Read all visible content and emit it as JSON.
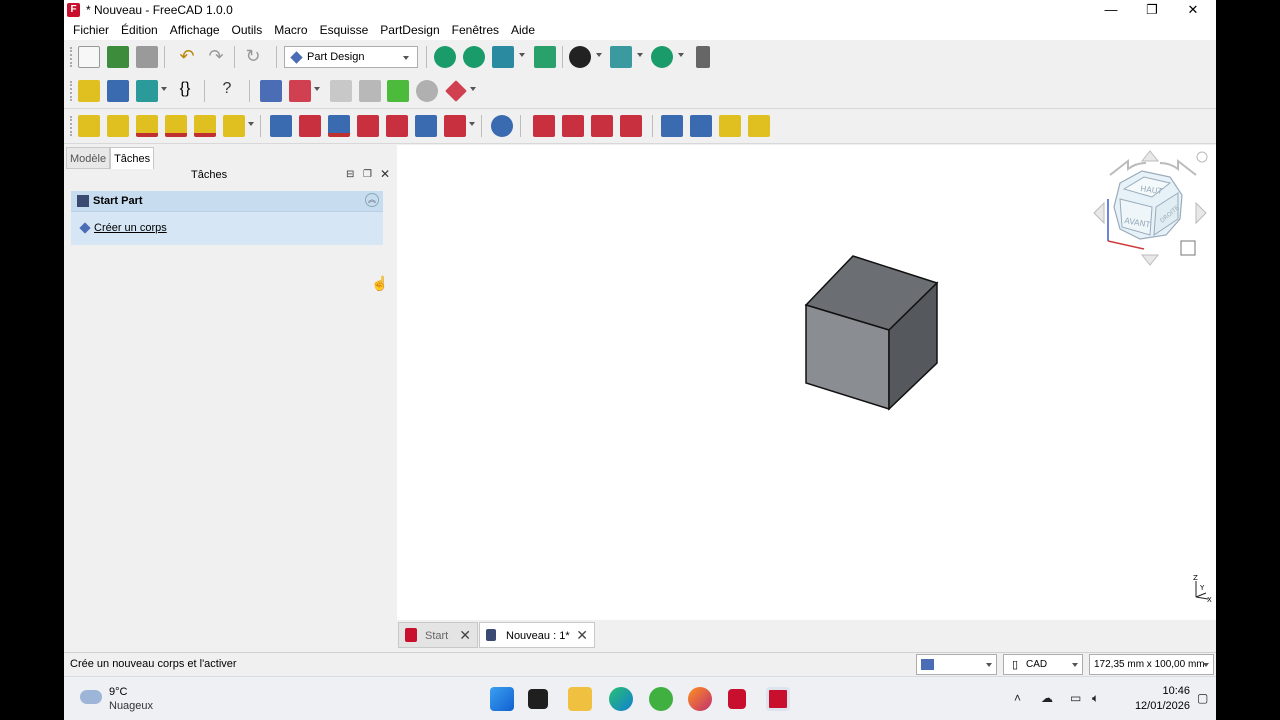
{
  "window": {
    "title": "* Nouveau - FreeCAD 1.0.0"
  },
  "menu": [
    "Fichier",
    "Édition",
    "Affichage",
    "Outils",
    "Macro",
    "Esquisse",
    "PartDesign",
    "Fenêtres",
    "Aide"
  ],
  "toolbar": {
    "workbench": "Part Design"
  },
  "panel": {
    "tabs": [
      "Modèle",
      "Tâches"
    ],
    "active_tab": "Tâches",
    "header": "Tâches",
    "taskbox_title": "Start Part",
    "action": "Créer un corps"
  },
  "navcube": {
    "top": "HAUT",
    "front": "AVANT",
    "right": "DROITE"
  },
  "axes": {
    "z": "Z",
    "y": "Y",
    "x": "X"
  },
  "doc_tabs": [
    {
      "label": "Start",
      "active": false
    },
    {
      "label": "Nouveau : 1*",
      "active": true
    }
  ],
  "status": {
    "message": "Crée un nouveau corps et l'activer",
    "nav_style": "CAD",
    "dimensions": "172,35 mm x 100,00 mm"
  },
  "taskbar": {
    "weather_temp": "9°C",
    "weather_cond": "Nuageux",
    "time": "10:46",
    "date": "12/01/2026"
  },
  "colors": {
    "cube_top": "#6b6e72",
    "cube_front": "#8a8d91",
    "cube_side": "#55585c",
    "task_bg": "#d6e6f5"
  }
}
